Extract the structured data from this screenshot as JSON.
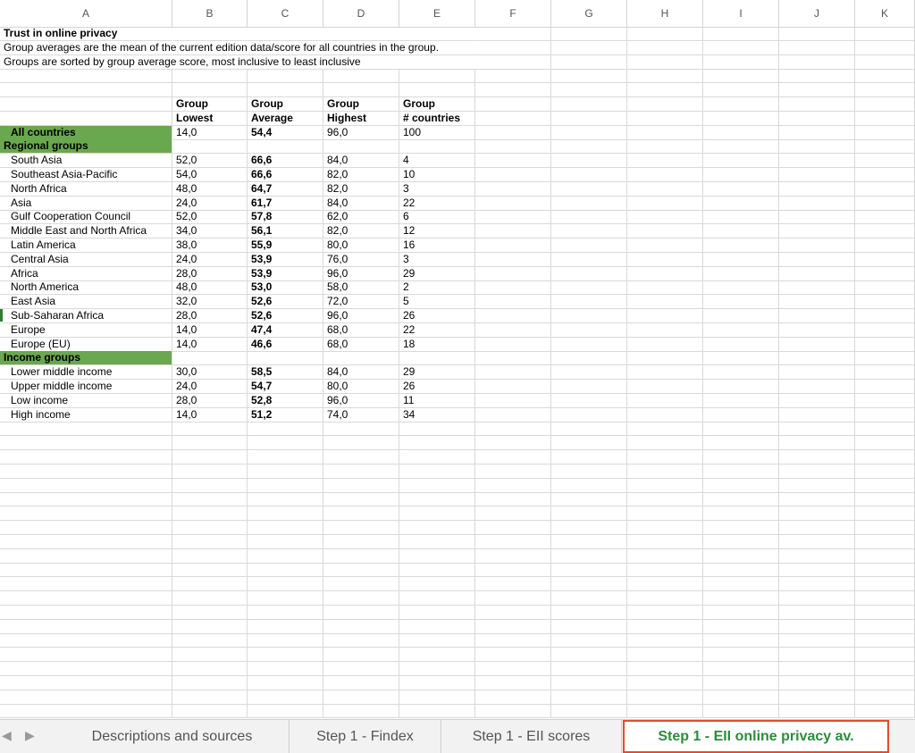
{
  "columns": [
    "A",
    "B",
    "C",
    "D",
    "E",
    "F",
    "G",
    "H",
    "I",
    "J",
    "K"
  ],
  "rows": [
    {
      "a": "Trust in online privacy",
      "a_style": "bold",
      "nob": true
    },
    {
      "a": "Group averages are the mean of the current edition data/score for all countries in the group.",
      "nob": true
    },
    {
      "a": "Groups are sorted by group average score, most inclusive to least inclusive",
      "nob": true
    },
    {},
    {},
    {
      "b": "Group",
      "c": "Group",
      "d": "Group",
      "e": "Group",
      "hdr": true
    },
    {
      "b": "Lowest",
      "c": "Average",
      "d": "Highest",
      "e": "# countries",
      "hdr": true
    },
    {
      "a": "All countries",
      "a_style": "green-indent",
      "b": "14,0",
      "c": "54,4",
      "d": "96,0",
      "e": "100"
    },
    {
      "a": "Regional groups",
      "a_style": "green"
    },
    {
      "a": "South Asia",
      "b": "52,0",
      "c": "66,6",
      "d": "84,0",
      "e": "4"
    },
    {
      "a": "Southeast Asia-Pacific",
      "b": "54,0",
      "c": "66,6",
      "d": "82,0",
      "e": "10"
    },
    {
      "a": "North Africa",
      "b": "48,0",
      "c": "64,7",
      "d": "82,0",
      "e": "3"
    },
    {
      "a": "Asia",
      "b": "24,0",
      "c": "61,7",
      "d": "84,0",
      "e": "22"
    },
    {
      "a": "Gulf Cooperation Council",
      "b": "52,0",
      "c": "57,8",
      "d": "62,0",
      "e": "6"
    },
    {
      "a": "Middle East and North Africa",
      "b": "34,0",
      "c": "56,1",
      "d": "82,0",
      "e": "12"
    },
    {
      "a": "Latin America",
      "b": "38,0",
      "c": "55,9",
      "d": "80,0",
      "e": "16"
    },
    {
      "a": "Central Asia",
      "b": "24,0",
      "c": "53,9",
      "d": "76,0",
      "e": "3"
    },
    {
      "a": "Africa",
      "b": "28,0",
      "c": "53,9",
      "d": "96,0",
      "e": "29"
    },
    {
      "a": "North America",
      "b": "48,0",
      "c": "53,0",
      "d": "58,0",
      "e": "2"
    },
    {
      "a": "East Asia",
      "b": "32,0",
      "c": "52,6",
      "d": "72,0",
      "e": "5"
    },
    {
      "a": "Sub-Saharan Africa",
      "b": "28,0",
      "c": "52,6",
      "d": "96,0",
      "e": "26"
    },
    {
      "a": "Europe",
      "b": "14,0",
      "c": "47,4",
      "d": "68,0",
      "e": "22"
    },
    {
      "a": "Europe (EU)",
      "b": "14,0",
      "c": "46,6",
      "d": "68,0",
      "e": "18"
    },
    {
      "a": "Income groups",
      "a_style": "green"
    },
    {
      "a": "Lower middle income",
      "b": "30,0",
      "c": "58,5",
      "d": "84,0",
      "e": "29"
    },
    {
      "a": "Upper middle income",
      "b": "24,0",
      "c": "54,7",
      "d": "80,0",
      "e": "26"
    },
    {
      "a": "Low income",
      "b": "28,0",
      "c": "52,8",
      "d": "96,0",
      "e": "11"
    },
    {
      "a": "High income",
      "b": "14,0",
      "c": "51,2",
      "d": "74,0",
      "e": "34"
    }
  ],
  "tabs": {
    "prev_arrow": "◀",
    "next_arrow": "▶",
    "items": [
      {
        "label": "Descriptions and sources",
        "active": false
      },
      {
        "label": "Step 1 - Findex",
        "active": false
      },
      {
        "label": "Step 1 - EII scores",
        "active": false
      },
      {
        "label": "Step 1 - EII online privacy av.",
        "active": true
      }
    ]
  },
  "colors": {
    "group_fill": "#6aa84f",
    "active_tab_text": "#2e8b3e",
    "active_tab_border": "#e8492e"
  }
}
